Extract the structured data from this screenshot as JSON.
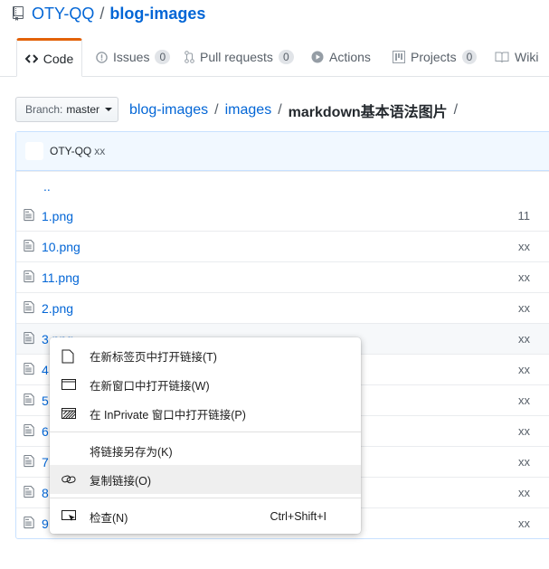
{
  "repo": {
    "owner": "OTY-QQ",
    "separator": "/",
    "name": "blog-images"
  },
  "tabs": [
    {
      "label": "Code",
      "icon": "code-icon",
      "selected": true
    },
    {
      "label": "Issues",
      "icon": "issue-icon",
      "count": "0"
    },
    {
      "label": "Pull requests",
      "icon": "pull-request-icon",
      "count": "0"
    },
    {
      "label": "Actions",
      "icon": "play-icon"
    },
    {
      "label": "Projects",
      "icon": "project-icon",
      "count": "0"
    },
    {
      "label": "Wiki",
      "icon": "book-icon"
    }
  ],
  "branch": {
    "prefix": "Branch:",
    "name": "master"
  },
  "breadcrumb": {
    "root": "blog-images",
    "folder": "images",
    "current": "markdown基本语法图片",
    "sep": "/"
  },
  "commit": {
    "user": "OTY-QQ",
    "message": "xx"
  },
  "updir": "..",
  "files": [
    {
      "name": "1.png",
      "age": "11"
    },
    {
      "name": "10.png",
      "age": "xx"
    },
    {
      "name": "11.png",
      "age": "xx"
    },
    {
      "name": "2.png",
      "age": "xx"
    },
    {
      "name": "3.png",
      "age": "xx"
    },
    {
      "name": "4.",
      "age": "xx"
    },
    {
      "name": "5.",
      "age": "xx"
    },
    {
      "name": "6.",
      "age": "xx"
    },
    {
      "name": "7.",
      "age": "xx"
    },
    {
      "name": "8.",
      "age": "xx"
    },
    {
      "name": "9.",
      "age": "xx"
    }
  ],
  "context_menu": {
    "open_new_tab": "在新标签页中打开链接(T)",
    "open_new_window": "在新窗口中打开链接(W)",
    "open_inprivate": "在 InPrivate 窗口中打开链接(P)",
    "save_link_as": "将链接另存为(K)",
    "copy_link": "复制链接(O)",
    "inspect": "检查(N)",
    "inspect_shortcut": "Ctrl+Shift+I"
  },
  "colors": {
    "link": "#0366d6",
    "tab_accent": "#e36209",
    "commit_bar": "#f1f8ff"
  }
}
